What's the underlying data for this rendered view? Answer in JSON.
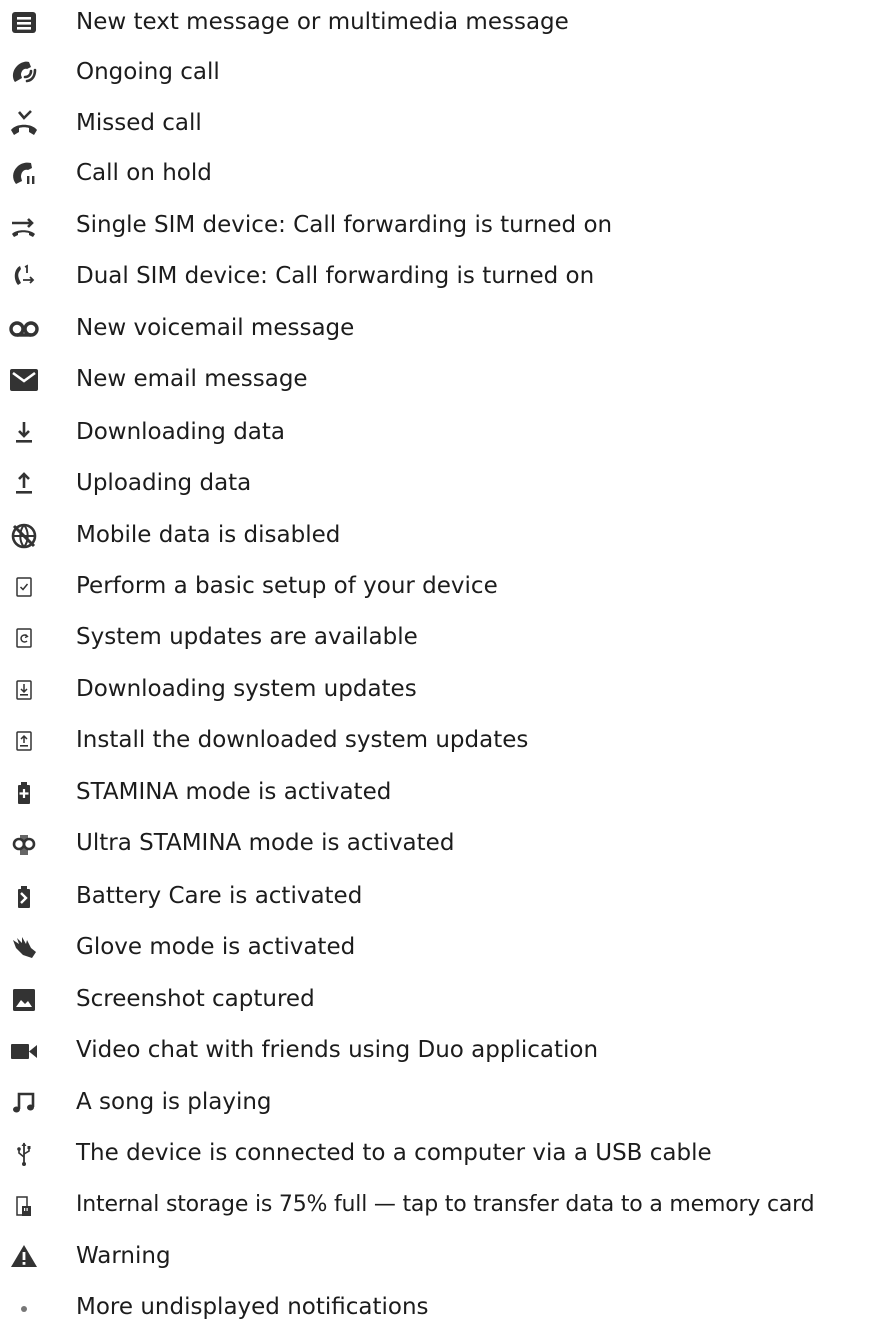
{
  "colors": {
    "icon": "#333333",
    "text": "#1c1c1c",
    "background": "#ffffff"
  },
  "items": [
    {
      "icon": "message-icon",
      "label": "New text message or multimedia message"
    },
    {
      "icon": "ongoing-call-icon",
      "label": "Ongoing call"
    },
    {
      "icon": "missed-call-icon",
      "label": "Missed call"
    },
    {
      "icon": "call-on-hold-icon",
      "label": "Call on hold"
    },
    {
      "icon": "call-forward-icon",
      "label": "Single SIM device: Call forwarding is turned on"
    },
    {
      "icon": "dual-sim-call-forward-icon",
      "label": "Dual SIM device: Call forwarding is turned on"
    },
    {
      "icon": "voicemail-icon",
      "label": "New voicemail message"
    },
    {
      "icon": "email-icon",
      "label": "New email message"
    },
    {
      "icon": "download-icon",
      "label": "Downloading data"
    },
    {
      "icon": "upload-icon",
      "label": "Uploading data"
    },
    {
      "icon": "mobile-data-disabled-icon",
      "label": "Mobile data is disabled"
    },
    {
      "icon": "setup-icon",
      "label": "Perform a basic setup of your device"
    },
    {
      "icon": "system-update-icon",
      "label": "System updates are available"
    },
    {
      "icon": "system-update-download-icon",
      "label": "Downloading system updates"
    },
    {
      "icon": "system-update-install-icon",
      "label": "Install the downloaded system updates"
    },
    {
      "icon": "stamina-icon",
      "label": "STAMINA mode is activated"
    },
    {
      "icon": "ultra-stamina-icon",
      "label": "Ultra STAMINA mode is activated"
    },
    {
      "icon": "battery-care-icon",
      "label": "Battery Care is activated"
    },
    {
      "icon": "glove-mode-icon",
      "label": "Glove mode is activated"
    },
    {
      "icon": "screenshot-icon",
      "label": "Screenshot captured"
    },
    {
      "icon": "video-chat-icon",
      "label": "Video chat with friends using Duo application"
    },
    {
      "icon": "music-note-icon",
      "label": "A song is playing"
    },
    {
      "icon": "usb-icon",
      "label": "The device is connected to a computer via a USB cable"
    },
    {
      "icon": "storage-card-icon",
      "label": "Internal storage is 75% full — tap to transfer data to a memory card"
    },
    {
      "icon": "warning-icon",
      "label": "Warning"
    },
    {
      "icon": "more-notifications-icon",
      "label": "More undisplayed notifications"
    }
  ]
}
